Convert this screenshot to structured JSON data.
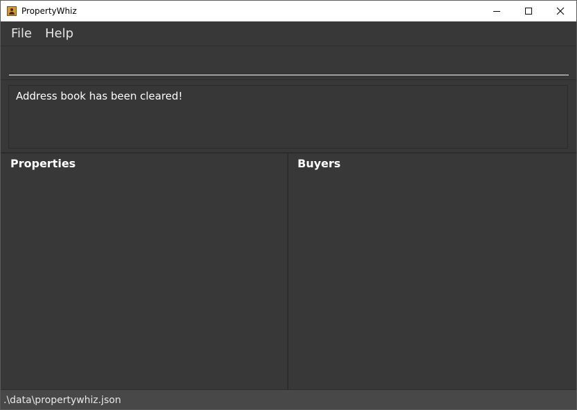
{
  "window": {
    "title": "PropertyWhiz",
    "controls": {
      "minimize": "minimize-icon",
      "maximize": "maximize-icon",
      "close": "close-icon"
    }
  },
  "menu": {
    "items": [
      {
        "label": "File"
      },
      {
        "label": "Help"
      }
    ]
  },
  "command_box": {
    "value": "",
    "placeholder": ""
  },
  "result_display": {
    "message": "Address book has been cleared!"
  },
  "lists": {
    "properties": {
      "title": "Properties",
      "items": []
    },
    "buyers": {
      "title": "Buyers",
      "items": []
    }
  },
  "status_bar": {
    "save_path": ".\\data\\propertywhiz.json"
  },
  "colors": {
    "background": "#383838",
    "text": "#ffffff",
    "status_bar": "#484848"
  }
}
